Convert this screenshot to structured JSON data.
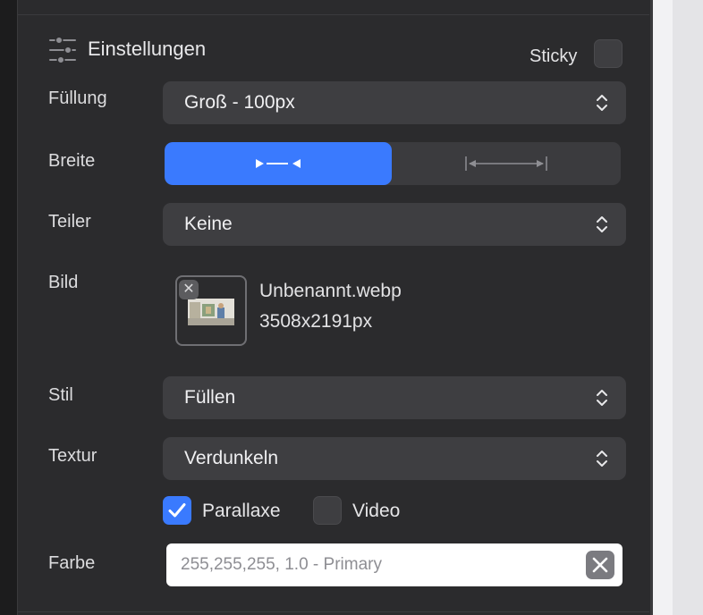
{
  "header": {
    "title": "Einstellungen",
    "icon": "sliders-icon"
  },
  "sticky": {
    "label": "Sticky",
    "checked": false
  },
  "fields": {
    "fuellung": {
      "label": "Füllung",
      "value": "Groß - 100px"
    },
    "breite": {
      "label": "Breite",
      "options": [
        "collapse-width-icon",
        "expand-width-icon"
      ],
      "selected_index": 0
    },
    "teiler": {
      "label": "Teiler",
      "value": "Keine"
    },
    "bild": {
      "label": "Bild",
      "file_name": "Unbenannt.webp",
      "dimensions": "3508x2191px"
    },
    "stil": {
      "label": "Stil",
      "value": "Füllen"
    },
    "textur": {
      "label": "Textur",
      "value": "Verdunkeln"
    },
    "parallaxe": {
      "label": "Parallaxe",
      "checked": true
    },
    "video": {
      "label": "Video",
      "checked": false
    },
    "farbe": {
      "label": "Farbe",
      "value": "255,255,255, 1.0 - Primary"
    }
  },
  "colors": {
    "accent": "#3a7afe",
    "panel": "#2b2b2d",
    "control": "#3e3e41"
  }
}
